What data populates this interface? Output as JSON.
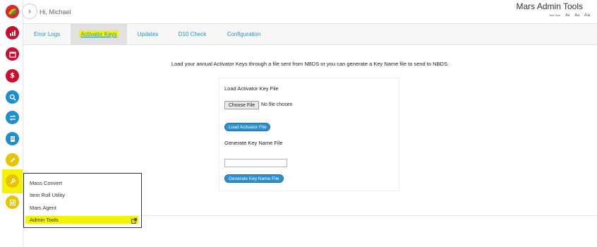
{
  "header": {
    "greeting": "Hi, Michael",
    "app_title": "Mars Admin Tools",
    "text_size_label": "Text Size",
    "text_size_options": [
      "Aa",
      "Aa",
      "Aa"
    ]
  },
  "rail": {
    "icons": [
      {
        "name": "logo-icon",
        "color": "#d9272e"
      },
      {
        "name": "bar-chart-icon",
        "color": "#c8102e"
      },
      {
        "name": "calendar-icon",
        "color": "#c8102e"
      },
      {
        "name": "dollar-icon",
        "color": "#c8102e"
      },
      {
        "name": "search-icon",
        "color": "#1a8fd1"
      },
      {
        "name": "transfer-icon",
        "color": "#1a8fd1"
      },
      {
        "name": "document-icon",
        "color": "#1a8fd1"
      },
      {
        "name": "pencil-icon",
        "color": "#e8c400"
      },
      {
        "name": "wrench-icon",
        "color": "#e8c400"
      },
      {
        "name": "report-icon",
        "color": "#e8c400"
      }
    ]
  },
  "tabs": [
    {
      "label": "Error Logs",
      "active": false
    },
    {
      "label": "Activator Keys",
      "active": true
    },
    {
      "label": "Updates",
      "active": false
    },
    {
      "label": "D10 Check",
      "active": false
    },
    {
      "label": "Configuration",
      "active": false
    }
  ],
  "content": {
    "intro": "Load your annual Activator Keys through a file sent from NBDS or you can generate a Key Name file to send to NBDS.",
    "load_section_label": "Load Activator Key File",
    "choose_file_label": "Choose File",
    "file_status": "No file chosen",
    "load_button": "Load Activator File",
    "generate_section_label": "Generate Key Name File",
    "key_name_value": "",
    "generate_button": "Generate Key Name File"
  },
  "flyout": {
    "items": [
      "Mass Convert",
      "Item Roll Utility",
      "Mars Agent",
      "Admin Tools"
    ],
    "highlight_color": "#f5f20a"
  },
  "colors": {
    "accent": "#2a8fc7",
    "highlight": "#f5f20a"
  }
}
